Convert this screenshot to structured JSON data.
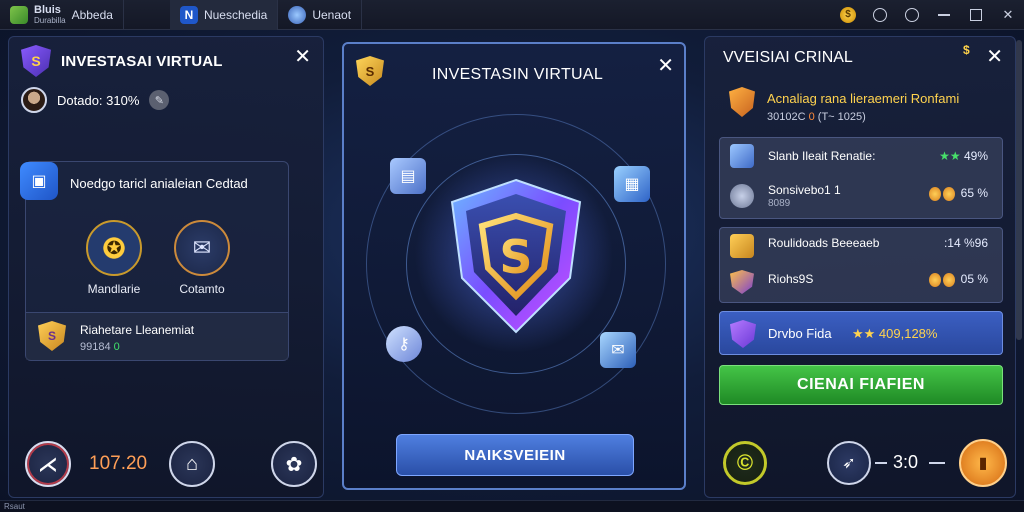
{
  "window": {
    "tabs": [
      {
        "title": "Bluis",
        "subtitle": "Durabilla",
        "label": "Abbeda"
      },
      {
        "label": "Nueschedia"
      },
      {
        "label": "Uenaot"
      }
    ],
    "coin_glyph": "$"
  },
  "left_panel": {
    "title": "INVESTASAI VIRTUAL",
    "shield_glyph": "S",
    "user_text": "Dotado: 310%",
    "card": {
      "title": "Noedgo taricl anialeian Cedtad",
      "buttons": [
        {
          "label": "Mandlarie"
        },
        {
          "label": "Cotamto"
        }
      ],
      "investment": {
        "title": "Riahetare Lleanemiat",
        "subtitle_prefix": "99184",
        "subtitle_green": "0"
      }
    },
    "bottom": {
      "number": "107.20"
    }
  },
  "center_panel": {
    "title": "INVESTASIN VIRTUAL",
    "shield_glyph": "S",
    "button_label": "NAIKSVEIEIN"
  },
  "right_panel": {
    "title": "VVEISIAI CRINAL",
    "alert": {
      "title": "Acnaliag rana lieraemeri Ronfami",
      "subtitle_prefix": "30102C",
      "subtitle_orange": "0",
      "subtitle_suffix": "(T~ 1025)"
    },
    "group1": [
      {
        "name": "Slanb Ileait Renatie:",
        "value": "49%",
        "stars": "★★"
      },
      {
        "name": "Sonsivebo1 1",
        "sub": "8089",
        "value": "65 %"
      }
    ],
    "group2": [
      {
        "name": "Roulidoads Beeeaeb",
        "value": ":14 %96"
      },
      {
        "name": "Riohs9S",
        "value": "05 %"
      }
    ],
    "blue_row": {
      "name": "Drvbo Fida",
      "value": "★★ 409,128%"
    },
    "green_button_label": "CIENAI FIAFIEN",
    "bottom": {
      "score": "3:0"
    }
  },
  "status_bar": {
    "text": "Rsaut"
  },
  "colors": {
    "accent_blue": "#4f7fe0",
    "accent_green": "#44c447",
    "accent_gold": "#ffd34f",
    "accent_orange": "#ff9f57"
  }
}
